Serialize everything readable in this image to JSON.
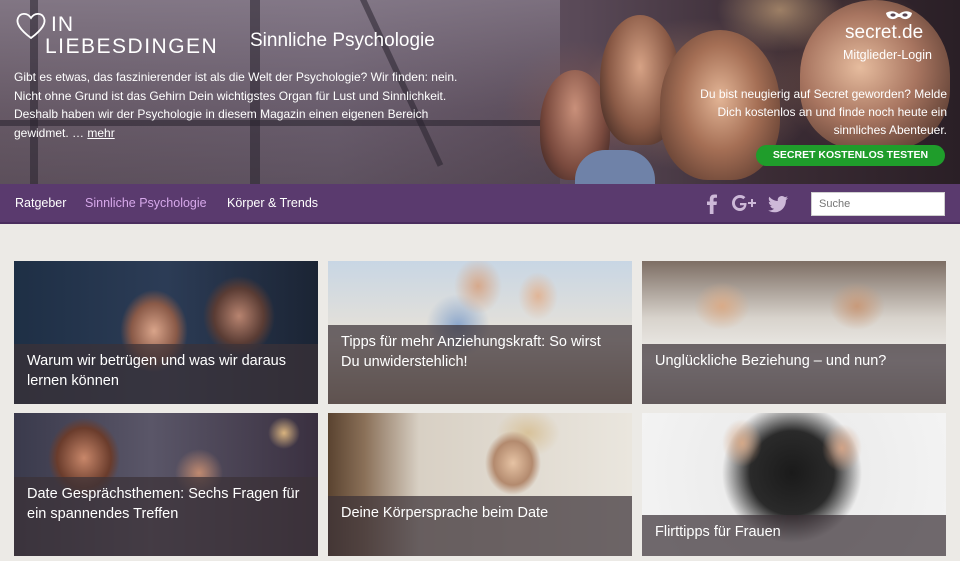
{
  "brand": {
    "logo_line1": "IN",
    "logo_line2": "LIEBESDINGEN",
    "subtitle": "Sinnliche Psychologie"
  },
  "intro": {
    "text": "Gibt es etwas, das faszinierender ist als die Welt der Psychologie? Wir finden: nein. Nicht ohne Grund ist das Gehirn Dein wichtigstes Organ für Lust und Sinnlichkeit. Deshalb haben wir der Psychologie in diesem Magazin einen eigenen Bereich gewidmet. … ",
    "more_label": "mehr"
  },
  "partner": {
    "logo_text": "secret.de",
    "login_label": "Mitglieder-Login",
    "promo_text": "Du bist neugierig auf Secret geworden? Melde Dich kostenlos an und finde noch heute ein sinnliches Abenteuer.",
    "cta_label": "SECRET KOSTENLOS TESTEN",
    "cta_color": "#1f9d2b"
  },
  "nav": {
    "items": [
      {
        "label": "Ratgeber",
        "active": false
      },
      {
        "label": "Sinnliche Psychologie",
        "active": true
      },
      {
        "label": "Körper & Trends",
        "active": false
      }
    ],
    "social_icons": [
      "facebook-icon",
      "google-plus-icon",
      "twitter-icon"
    ],
    "search_placeholder": "Suche",
    "background_color": "#5a3a6e",
    "active_color": "#d6a8ea"
  },
  "articles": [
    {
      "title": "Warum wir betrügen und was wir daraus lernen können"
    },
    {
      "title": "Tipps für mehr Anziehungskraft: So wirst Du unwiderstehlich!"
    },
    {
      "title": "Unglückliche Beziehung – und nun?"
    },
    {
      "title": "Date Gesprächsthemen: Sechs Fragen für ein spannendes Treffen"
    },
    {
      "title": "Deine Körpersprache beim Date"
    },
    {
      "title": "Flirttipps für Frauen"
    }
  ]
}
